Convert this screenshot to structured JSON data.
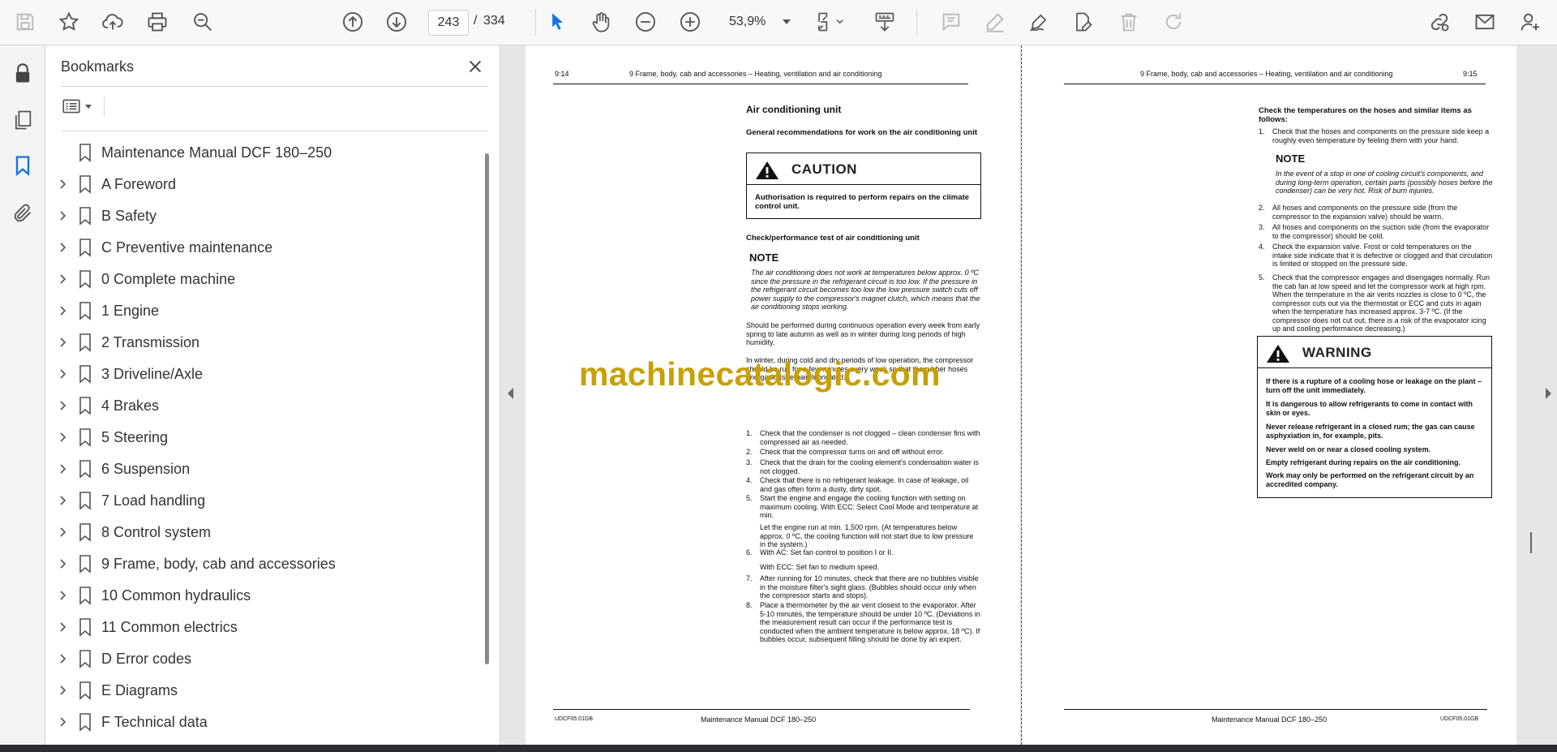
{
  "toolbar": {
    "current_page": "243",
    "page_separator": "/",
    "total_pages": "334",
    "zoom": "53,9%"
  },
  "bookmarks": {
    "title": "Bookmarks",
    "items": [
      {
        "label": "Maintenance Manual DCF 180–250",
        "expandable": false
      },
      {
        "label": "A Foreword",
        "expandable": true
      },
      {
        "label": "B Safety",
        "expandable": true
      },
      {
        "label": "C Preventive maintenance",
        "expandable": true
      },
      {
        "label": "0 Complete machine",
        "expandable": true
      },
      {
        "label": "1 Engine",
        "expandable": true
      },
      {
        "label": "2 Transmission",
        "expandable": true
      },
      {
        "label": "3 Driveline/Axle",
        "expandable": true
      },
      {
        "label": "4 Brakes",
        "expandable": true
      },
      {
        "label": "5 Steering",
        "expandable": true
      },
      {
        "label": "6 Suspension",
        "expandable": true
      },
      {
        "label": "7 Load handling",
        "expandable": true
      },
      {
        "label": "8 Control system",
        "expandable": true
      },
      {
        "label": "9 Frame, body, cab and accessories",
        "expandable": true
      },
      {
        "label": "10 Common hydraulics",
        "expandable": true
      },
      {
        "label": "11 Common electrics",
        "expandable": true
      },
      {
        "label": "D Error codes",
        "expandable": true
      },
      {
        "label": "E Diagrams",
        "expandable": true
      },
      {
        "label": "F Technical data",
        "expandable": true
      }
    ]
  },
  "colors": {
    "accent": "#1473e6",
    "watermark": "#c8a008"
  },
  "left_page": {
    "page_no": "9:14",
    "header": "9 Frame, body, cab and accessories – Heating, ventilation and air conditioning",
    "title": "Air conditioning unit",
    "subtitle": "General recommendations for work on the air conditioning unit",
    "caution_word": "CAUTION",
    "caution_text": "Authorisation is required to perform repairs on the climate control unit.",
    "check_heading": "Check/performance test of air conditioning unit",
    "note_word": "NOTE",
    "note_text": "The air conditioning does not work at temperatures below approx. 0 ºC since the pressure in the refrigerant circuit is too low.  If the pressure in the refrigerant circuit becomes too low the low pressure switch cuts off power supply to the compressor's magnet clutch, which means that the air conditioning stops working.",
    "para1": "Should be performed during continuous operation every week from early spring to late autumn as well as in winter during long periods of high humidity.",
    "para2": "In winter, during cold and dry periods of low operation, the compressor should be run for a few minutes every week so that the rubber hoses and gaskets remain lubricated.",
    "steps": [
      {
        "n": "1.",
        "t": "Check that the condenser is not clogged – clean condenser fins with compressed air as needed."
      },
      {
        "n": "2.",
        "t": "Check that the compressor turns on and off without error."
      },
      {
        "n": "3.",
        "t": "Check that the drain for the cooling element's condensation water is not clogged."
      },
      {
        "n": "4.",
        "t": "Check that there is no refrigerant leakage.  In case of leakage, oil and gas often form a dusty, dirty spot."
      },
      {
        "n": "5.",
        "t": "Start the engine and engage the cooling function with setting on maximum cooling. With ECC: Select Cool Mode and temperature at min."
      },
      {
        "n": "",
        "t": "Let the engine run at min. 1,500 rpm.  (At temperatures below approx. 0 ºC, the cooling function will not start due to low pressure in the system.)"
      },
      {
        "n": "6.",
        "t": "With AC: Set fan control to position I or II."
      },
      {
        "n": "",
        "t": "With ECC: Set fan to medium speed."
      },
      {
        "n": "7.",
        "t": "After running for 10 minutes, check that there are no bubbles visible in the moisture filter's sight glass. (Bubbles should occur only when the compressor starts and stops)."
      },
      {
        "n": "8.",
        "t": "Place a thermometer by the air vent closest to the evaporator. After 5-10 minutes, the temperature should be under 10 ºC. (Deviations in the measurement result can occur if the performance test is conducted when the ambient temperature is below approx. 18 ºC). If bubbles occur, subsequent filling should be done by an expert."
      }
    ],
    "footer_code": "UDCF05.01GB",
    "footer_title": "Maintenance Manual DCF 180–250"
  },
  "right_page": {
    "page_no": "9:15",
    "header": "9 Frame, body, cab and accessories – Heating, ventilation and air conditioning",
    "intro": "Check the temperatures on the hoses and similar items as follows:",
    "step1": {
      "n": "1.",
      "t": "Check that the hoses and components on the pressure side keep a roughly even temperature by feeling them with your hand."
    },
    "note_word": "NOTE",
    "note_text": "In the event of a stop in one of cooling circuit's components, and during long-term operation, certain parts (possibly hoses before the condenser) can be very hot.  Risk of burn injuries.",
    "steps": [
      {
        "n": "2.",
        "t": "All hoses and components on the pressure side (from the compressor to the expansion valve) should be warm."
      },
      {
        "n": "3.",
        "t": "All hoses and components on the suction side (from the evaporator to the compressor) should be cold."
      },
      {
        "n": "4.",
        "t": "Check the expansion valve.  Frost or cold temperatures on the intake side indicate that it is defective or clogged and that circulation is limited or stopped on the pressure side."
      },
      {
        "n": "5.",
        "t": "Check that the compressor engages and disengages normally. Run the cab fan at low speed and let the compressor work at high rpm.  When the temperature in the air vents nozzles is close to 0 ºC, the compressor cuts out via the thermostat or ECC and cuts in again when the temperature has increased approx. 3-7 ºC. (If the compressor does not cut out, there is a risk of the evaporator icing up and cooling performance decreasing.)"
      }
    ],
    "warning_word": "WARNING",
    "warning_lines": [
      "If there is a rupture of a cooling hose or leakage on the plant – turn off the unit immediately.",
      "It is dangerous to allow refrigerants to come in contact with skin or eyes.",
      "Never release refrigerant in a closed rum; the gas can cause asphyxiation in, for example, pits.",
      "Never weld on or near a closed cooling system.",
      "Empty refrigerant during repairs on the air conditioning.",
      "Work may only be performed on the refrigerant circuit by an accredited company."
    ],
    "footer_title": "Maintenance Manual DCF 180–250",
    "footer_code": "UDCF05.01GB"
  },
  "watermark": "machinecatalogic.com"
}
